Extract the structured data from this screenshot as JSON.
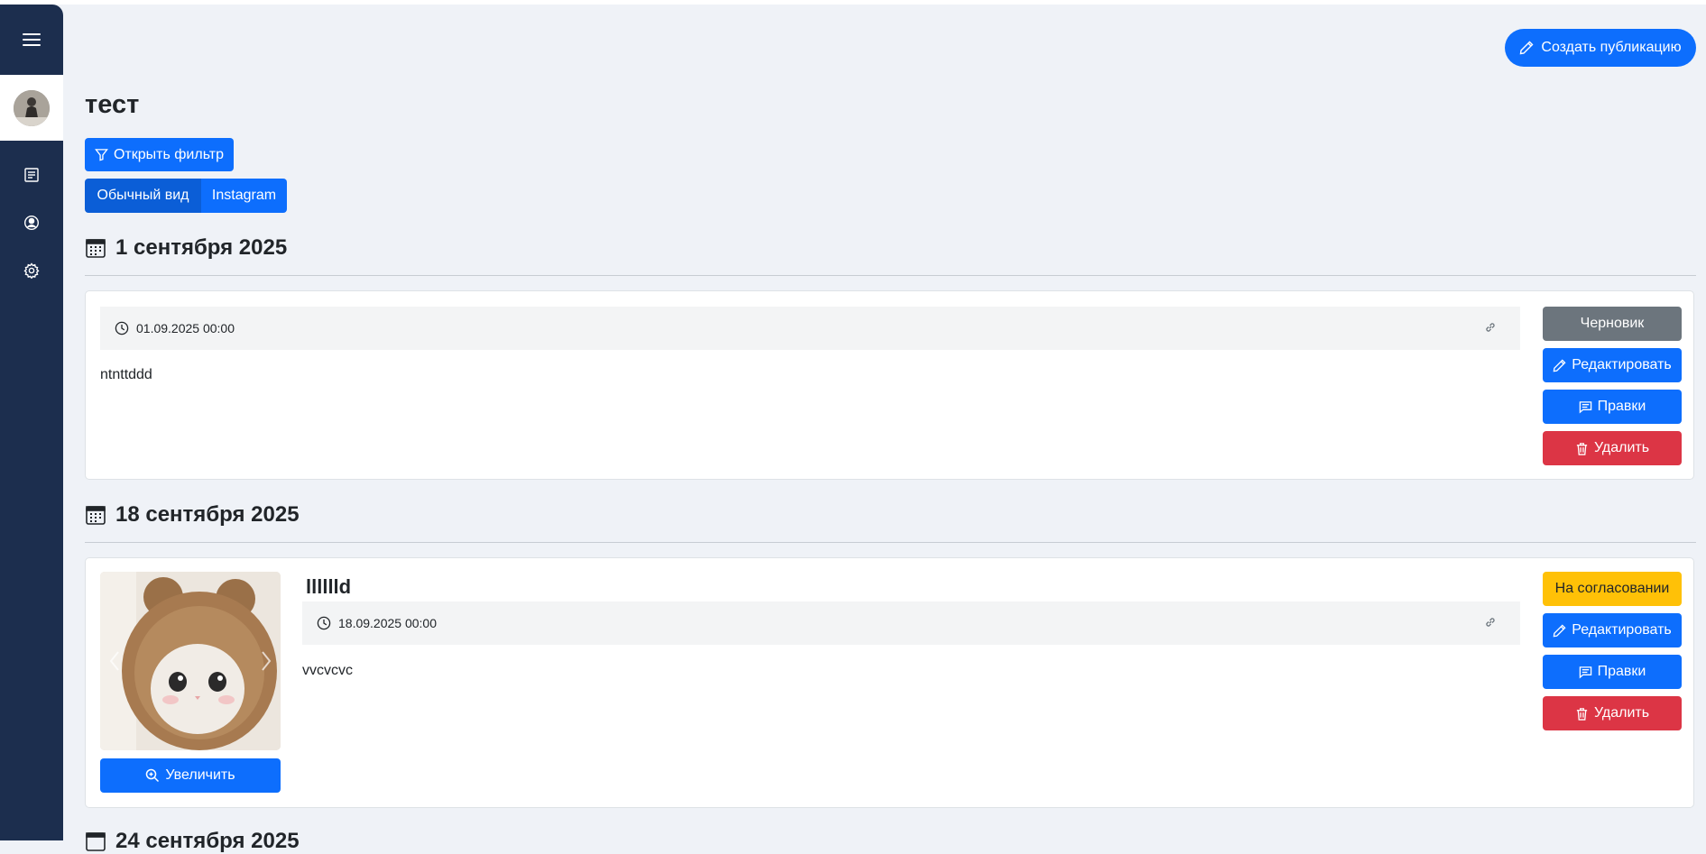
{
  "header": {
    "create_label": "Создать публикацию"
  },
  "page": {
    "title": "тест"
  },
  "filter": {
    "label": "Открыть фильтр"
  },
  "view_toggle": {
    "normal_label": "Обычный вид",
    "instagram_label": "Instagram"
  },
  "groups": [
    {
      "date": "1 сентября 2025",
      "post": {
        "datetime": "01.09.2025 00:00",
        "text": "ntnttddd",
        "status": "Черновик",
        "edit_label": "Редактировать",
        "comments_label": "Правки",
        "delete_label": "Удалить"
      }
    },
    {
      "date": "18 сентября 2025",
      "post": {
        "title": "lllllld",
        "datetime": "18.09.2025 00:00",
        "text": "vvcvcvc",
        "status": "На согласовании",
        "edit_label": "Редактировать",
        "comments_label": "Правки",
        "delete_label": "Удалить",
        "zoom_label": "Увеличить"
      }
    },
    {
      "date": "24 сентября 2025"
    }
  ],
  "colors": {
    "primary": "#0d6efd",
    "primary_active": "#0b5ed7",
    "danger": "#dc3545",
    "warning": "#ffc107",
    "secondary": "#6c757d",
    "sidebar": "#1c2e4e",
    "page_bg": "#eff2f7"
  },
  "icons": {
    "sidebar": [
      "menu-icon",
      "avatar",
      "document-icon",
      "user-circle-icon",
      "gear-icon"
    ],
    "actions": [
      "pencil-icon",
      "funnel-icon",
      "calendar-icon",
      "clock-icon",
      "link-icon",
      "chat-icon",
      "trash-icon",
      "zoom-in-icon",
      "chevron-left-icon",
      "chevron-right-icon"
    ]
  }
}
